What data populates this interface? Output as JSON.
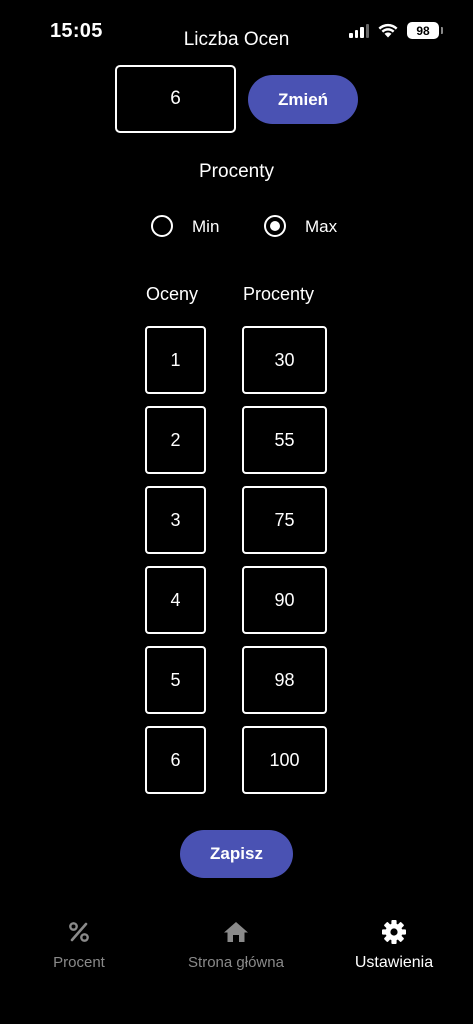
{
  "status": {
    "time": "15:05",
    "battery": "98"
  },
  "header": {
    "title": "Liczba Ocen"
  },
  "count": {
    "value": "6",
    "change_label": "Zmień"
  },
  "mode": {
    "title": "Procenty",
    "options": [
      {
        "label": "Min",
        "checked": false
      },
      {
        "label": "Max",
        "checked": true
      }
    ]
  },
  "table": {
    "headers": [
      "Oceny",
      "Procenty"
    ],
    "rows": [
      {
        "grade": "1",
        "percent": "30"
      },
      {
        "grade": "2",
        "percent": "55"
      },
      {
        "grade": "3",
        "percent": "75"
      },
      {
        "grade": "4",
        "percent": "90"
      },
      {
        "grade": "5",
        "percent": "98"
      },
      {
        "grade": "6",
        "percent": "100"
      }
    ]
  },
  "save_label": "Zapisz",
  "nav": {
    "items": [
      {
        "label": "Procent",
        "icon": "percent-icon",
        "active": false
      },
      {
        "label": "Strona główna",
        "icon": "home-icon",
        "active": false
      },
      {
        "label": "Ustawienia",
        "icon": "gear-icon",
        "active": true
      }
    ]
  },
  "colors": {
    "accent": "#4a52b3",
    "background": "#000000",
    "inactive": "#8a8a8a"
  }
}
